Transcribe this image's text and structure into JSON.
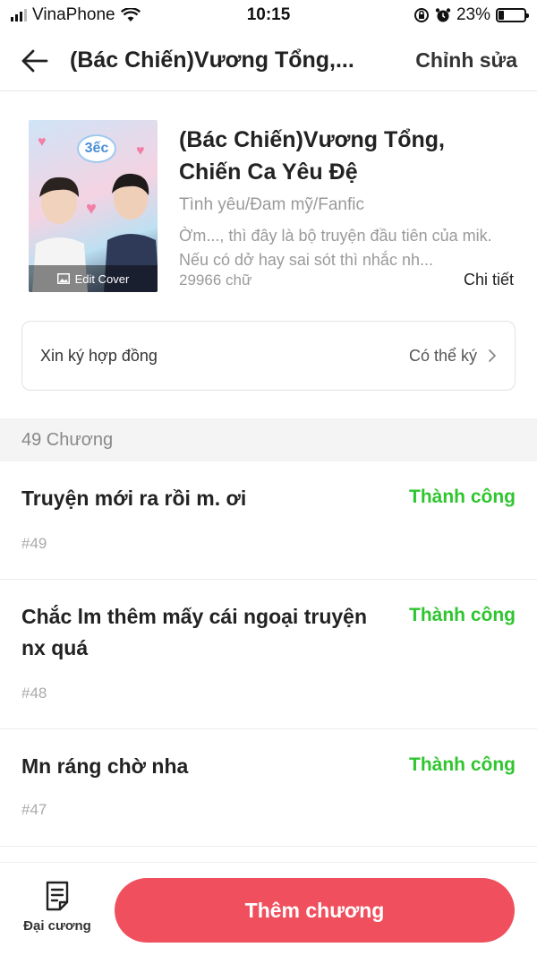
{
  "status_bar": {
    "carrier": "VinaPhone",
    "time": "10:15",
    "battery_percent": "23%",
    "battery_level": 0.23,
    "icons": [
      "signal-icon",
      "wifi-icon",
      "rotation-lock-icon",
      "alarm-icon",
      "battery-icon"
    ]
  },
  "nav": {
    "title": "(Bác Chiến)Vương Tổng,...",
    "edit_label": "Chỉnh sửa",
    "back_icon": "arrow-left-icon"
  },
  "book": {
    "cover_label": "Edit Cover",
    "cover_bubble_text": "3ếc",
    "title": "(Bác Chiến)Vương Tổng, Chiến Ca Yêu Đệ",
    "genre": "Tình yêu/Đam mỹ/Fanfic",
    "description": "Ờm..., thì đây là bộ truyện đầu tiên của mik. Nếu có dở hay sai sót thì nhắc nh...",
    "word_count": "29966 chữ",
    "detail_label": "Chi tiết"
  },
  "contract": {
    "label": "Xin ký hợp đồng",
    "status": "Có thể ký"
  },
  "chapters": {
    "header": "49 Chương",
    "items": [
      {
        "title": "Truyện mới ra rồi m. ơi",
        "number": "#49",
        "status": "Thành công"
      },
      {
        "title": "Chắc lm thêm mấy cái ngoại truyện nx quá",
        "number": "#48",
        "status": "Thành công"
      },
      {
        "title": "Mn ráng chờ nha",
        "number": "#47",
        "status": "Thành công"
      }
    ]
  },
  "bottom": {
    "outline_label": "Đại cương",
    "add_chapter_label": "Thêm chương"
  },
  "colors": {
    "accent": "#f0505e",
    "success": "#2fc52f",
    "muted": "#9a9a9a"
  }
}
